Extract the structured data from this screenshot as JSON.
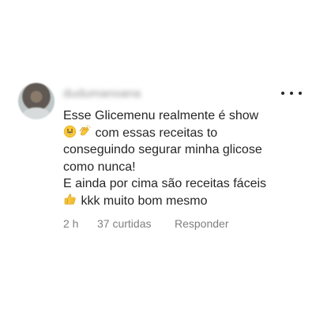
{
  "author": {
    "avatar_icon": "user-avatar",
    "username_blurred": "dudumanoana"
  },
  "comment": {
    "lines": [
      "Esse Glicemenu realmente é show",
      " com essas receitas to",
      "conseguindo segurar minha  glicose",
      "como nunca!",
      "E ainda por cima são receitas fáceis",
      " kkk  muito bom mesmo"
    ],
    "emoji_icons": [
      "grinning-face-icon",
      "clapping-hands-icon",
      "thumbs-up-icon"
    ]
  },
  "meta": {
    "time": "2 h",
    "likes": "37 curtidas",
    "reply_label": "Responder"
  },
  "menu_icon": "more-options-icon",
  "colors": {
    "primary_text": "#262626",
    "secondary_text": "#7f7f7f",
    "background": "#ffffff",
    "emoji_yellow": "#f7c83a"
  }
}
